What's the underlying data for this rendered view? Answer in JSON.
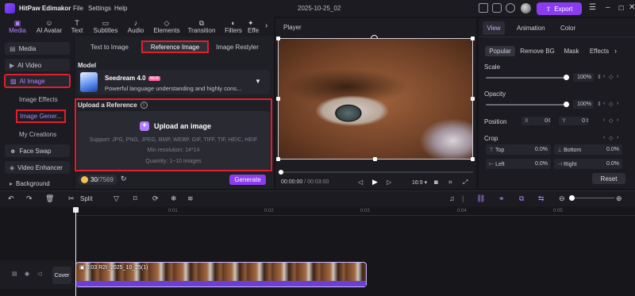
{
  "app": {
    "name": "HitPaw Edimakor",
    "project_name": "2025-10-25_02"
  },
  "menu": [
    "File",
    "Settings",
    "Help"
  ],
  "export_label": "Export",
  "toolbar": [
    {
      "label": "Media",
      "icon": "media-icon",
      "active": true
    },
    {
      "label": "AI Avatar",
      "icon": "ai-avatar-icon"
    },
    {
      "label": "Text",
      "icon": "text-icon"
    },
    {
      "label": "Subtitles",
      "icon": "subtitles-icon"
    },
    {
      "label": "Audio",
      "icon": "audio-icon"
    },
    {
      "label": "Elements",
      "icon": "elements-icon"
    },
    {
      "label": "Transition",
      "icon": "transition-icon"
    },
    {
      "label": "Filters",
      "icon": "filters-icon"
    },
    {
      "label": "Effe",
      "icon": "effects-icon"
    }
  ],
  "sidebar": {
    "items": [
      "Media",
      "AI Video",
      "AI Image",
      "Image Effects",
      "Image Gener...",
      "My Creations",
      "Face Swap",
      "Video Enhancer",
      "Background"
    ]
  },
  "ai_panel": {
    "tabs": [
      "Text to Image",
      "Reference Image",
      "Image Restyler"
    ],
    "active_tab": "Reference Image",
    "model_heading": "Model",
    "model_name": "Seedream 4.0",
    "model_badge": "NEW",
    "model_desc": "Powerful language understanding and highly cons...",
    "upload_heading": "Upload a Reference",
    "upload_label": "Upload an image",
    "support": "Support: JPG, PNG, JPEG, BMP, WEBP, GIF, TIFF, TIF, HEIC, HEIF",
    "min_res": "Min resolution: 14*14",
    "quantity": "Quantity: 1~10 images",
    "credits_used": "30",
    "credits_total": "/7569",
    "generate_label": "Generate"
  },
  "player": {
    "title": "Player",
    "time_current": "00:00:00",
    "time_total": "/ 00:03:00",
    "aspect": "16:9"
  },
  "right_panel": {
    "tabs": [
      "View",
      "Animation",
      "Color"
    ],
    "active_tab": "View",
    "subtabs": [
      "Popular",
      "Remove BG",
      "Mask",
      "Effects"
    ],
    "scale_label": "Scale",
    "scale_value": "100%",
    "scale_level": 1.0,
    "opacity_label": "Opacity",
    "opacity_value": "100%",
    "opacity_level": 1.0,
    "position_label": "Position",
    "pos_x_label": "X",
    "pos_x": "0",
    "pos_y_label": "Y",
    "pos_y": "0",
    "crop_label": "Crop",
    "crop_top_label": "Top",
    "crop_top": "0.0%",
    "crop_bottom_label": "Bottom",
    "crop_bottom": "0.0%",
    "crop_left_label": "Left",
    "crop_left": "0.0%",
    "crop_right_label": "Right",
    "crop_right": "0.0%",
    "reset_label": "Reset"
  },
  "timeline": {
    "split_label": "Split",
    "ticks": [
      "0:01",
      "0:02",
      "0:03",
      "0:04",
      "0:05"
    ],
    "cover_label": "Cover",
    "clip_label": "0:03  R2I_2025_10_25(1)"
  },
  "colors": {
    "accent": "#8b3cf0",
    "highlight_box": "#e0202c"
  }
}
